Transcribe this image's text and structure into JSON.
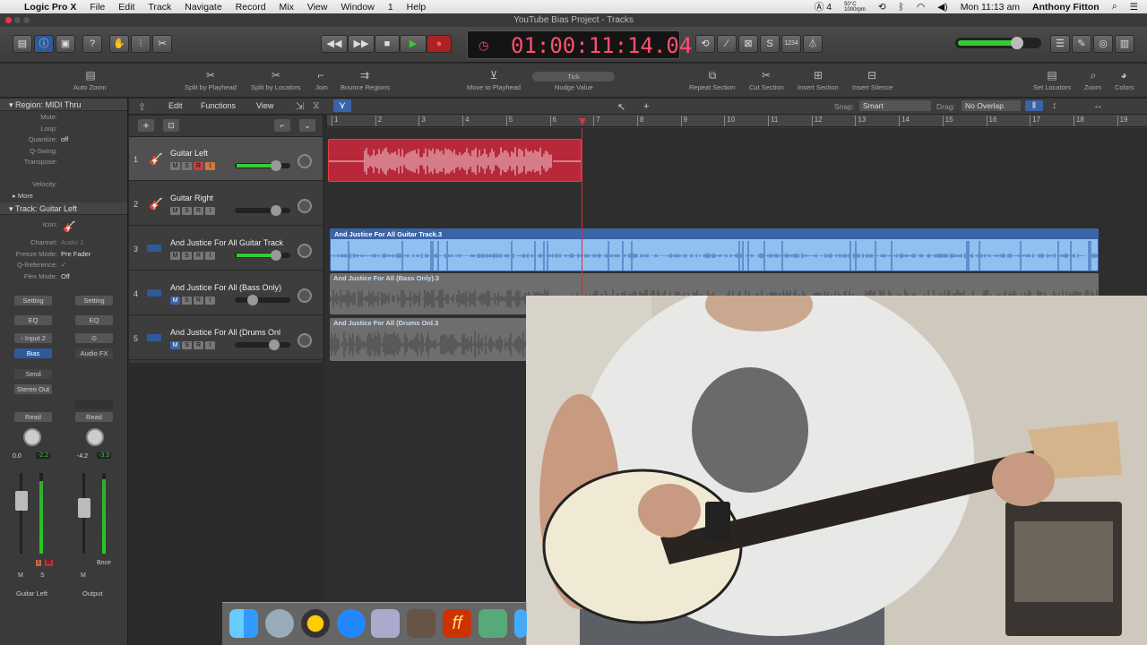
{
  "menubar": {
    "app_name": "Logic Pro X",
    "items": [
      "File",
      "Edit",
      "Track",
      "Navigate",
      "Record",
      "Mix",
      "View",
      "Window",
      "1",
      "Help"
    ],
    "status_adobe": "4",
    "status_temp": "50°C",
    "status_rpm": "1000rpm",
    "clock": "Mon 11:13 am",
    "user": "Anthony Fitton"
  },
  "window": {
    "title": "YouTube Bias Project - Tracks"
  },
  "transport": {
    "lcd_time": "01:00:11:14.04",
    "cycle_counter": "1234"
  },
  "toolbar": {
    "items": [
      "Auto Zoom",
      "Split by Playhead",
      "Split by Locators",
      "Join",
      "Bounce Regions",
      "Move to Playhead",
      "Nudge Value",
      "Repeat Section",
      "Cut Section",
      "Insert Section",
      "Insert Silence",
      "Set Locators",
      "Zoom",
      "Colors"
    ],
    "nudge_value": "Tick"
  },
  "inspector": {
    "region_header": "Region: MIDI Thru",
    "region_rows": [
      {
        "k": "Mute:",
        "v": ""
      },
      {
        "k": "Loop:",
        "v": ""
      },
      {
        "k": "Quantize:",
        "v": "off"
      },
      {
        "k": "Q-Swing:",
        "v": ""
      },
      {
        "k": "Transpose:",
        "v": ""
      },
      {
        "k": "",
        "v": ""
      },
      {
        "k": "Velocity:",
        "v": ""
      }
    ],
    "more_label": "More",
    "track_header": "Track:  Guitar Left",
    "track_rows": [
      {
        "k": "Icon:",
        "v": ""
      },
      {
        "k": "Channel:",
        "v": "Audio 1"
      },
      {
        "k": "Freeze Mode:",
        "v": "Pre Fader"
      },
      {
        "k": "Q-Reference:",
        "v": "✓"
      },
      {
        "k": "Flex Mode:",
        "v": "Off"
      }
    ]
  },
  "mixer": {
    "strip1": {
      "setting": "Setting",
      "eq": "EQ",
      "input": "Input 2",
      "plugin": "Bias",
      "send": "Send",
      "output": "Stereo Out",
      "automation": "Read",
      "vol": "0.0",
      "peak": "-2.2",
      "name": "Guitar Left"
    },
    "strip2": {
      "setting": "Setting",
      "eq": "EQ",
      "plugin": "Audio FX",
      "automation": "Read",
      "vol": "-4.2",
      "peak": "-3.3",
      "bounce": "Bnce",
      "name": "Output"
    }
  },
  "arrange_header": {
    "menus": [
      "Edit",
      "Functions",
      "View"
    ],
    "snap_label": "Snap:",
    "snap_value": "Smart",
    "drag_label": "Drag:",
    "drag_value": "No Overlap"
  },
  "ruler": [
    "1",
    "2",
    "3",
    "4",
    "5",
    "6",
    "7",
    "8",
    "9",
    "10",
    "11",
    "12",
    "13",
    "14",
    "15",
    "16",
    "17",
    "18",
    "19"
  ],
  "tracks": [
    {
      "num": "1",
      "name": "Guitar Left"
    },
    {
      "num": "2",
      "name": "Guitar Right"
    },
    {
      "num": "3",
      "name": "And Justice For All Guitar Track"
    },
    {
      "num": "4",
      "name": "And Justice For All (Bass Only)"
    },
    {
      "num": "5",
      "name": "And Justice For All (Drums Onl"
    }
  ],
  "regions": [
    {
      "name": "And Justice For All Guitar Track.3"
    },
    {
      "name": "And Justice For All (Bass Only).3"
    },
    {
      "name": "And Justice For All (Drums Onl.3"
    }
  ],
  "colors": {
    "record_region": "#b8283a",
    "guitar_region": "#8fc0f0",
    "gray_region": "#777777",
    "lcd": "#ff5070"
  }
}
